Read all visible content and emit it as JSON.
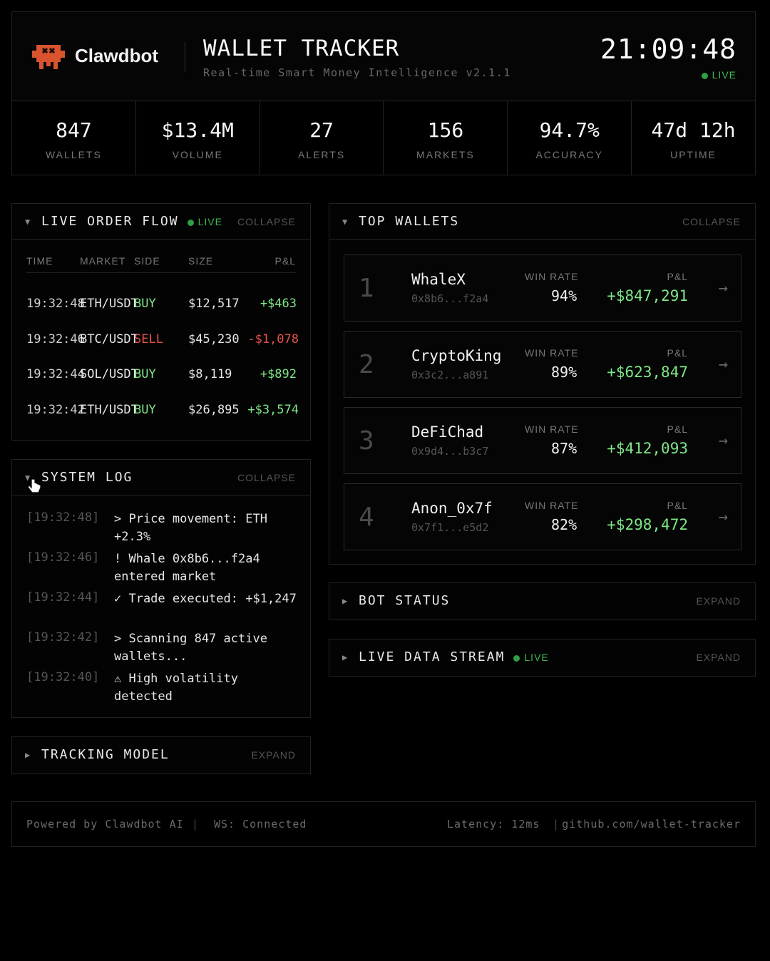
{
  "header": {
    "brand": "Clawdbot",
    "title": "WALLET TRACKER",
    "subtitle": "Real-time Smart Money Intelligence v2.1.1",
    "clock": "21:09:48",
    "live": "LIVE",
    "logo_icon": "clawdbot-logo-icon",
    "accent_color": "#d9532e"
  },
  "stats": [
    {
      "value": "847",
      "label": "WALLETS"
    },
    {
      "value": "$13.4M",
      "label": "VOLUME"
    },
    {
      "value": "27",
      "label": "ALERTS"
    },
    {
      "value": "156",
      "label": "MARKETS"
    },
    {
      "value": "94.7%",
      "label": "ACCURACY"
    },
    {
      "value": "47d 12h",
      "label": "UPTIME"
    }
  ],
  "order_flow": {
    "title": "LIVE ORDER FLOW",
    "live": "LIVE",
    "action": "COLLAPSE",
    "columns": [
      "TIME",
      "MARKET",
      "SIDE",
      "SIZE",
      "P&L"
    ],
    "rows": [
      {
        "time": "19:32:48",
        "market": "ETH/USDT",
        "side": "BUY",
        "size": "$12,517",
        "pnl": "+$463"
      },
      {
        "time": "19:32:46",
        "market": "BTC/USDT",
        "side": "SELL",
        "size": "$45,230",
        "pnl": "-$1,078"
      },
      {
        "time": "19:32:44",
        "market": "SOL/USDT",
        "side": "BUY",
        "size": "$8,119",
        "pnl": "+$892"
      },
      {
        "time": "19:32:42",
        "market": "ETH/USDT",
        "side": "BUY",
        "size": "$26,895",
        "pnl": "+$3,574"
      }
    ]
  },
  "system_log": {
    "title": "SYSTEM LOG",
    "action": "COLLAPSE",
    "entries": [
      {
        "time": "[19:32:48]",
        "msg": "> Price movement: ETH +2.3%"
      },
      {
        "time": "[19:32:46]",
        "msg": "! Whale 0x8b6...f2a4 entered market"
      },
      {
        "time": "[19:32:44]",
        "msg": "✓ Trade executed: +$1,247"
      },
      {
        "time": "[19:32:42]",
        "msg": "> Scanning 847 active wallets..."
      },
      {
        "time": "[19:32:40]",
        "msg": "⚠ High volatility detected"
      }
    ]
  },
  "tracking_model": {
    "title": "TRACKING MODEL",
    "action": "EXPAND"
  },
  "top_wallets": {
    "title": "TOP WALLETS",
    "action": "COLLAPSE",
    "win_rate_label": "WIN RATE",
    "pnl_label": "P&L",
    "wallets": [
      {
        "rank": "1",
        "name": "WhaleX",
        "address": "0x8b6...f2a4",
        "win_rate": "94%",
        "pnl": "+$847,291"
      },
      {
        "rank": "2",
        "name": "CryptoKing",
        "address": "0x3c2...a891",
        "win_rate": "89%",
        "pnl": "+$623,847"
      },
      {
        "rank": "3",
        "name": "DeFiChad",
        "address": "0x9d4...b3c7",
        "win_rate": "87%",
        "pnl": "+$412,093"
      },
      {
        "rank": "4",
        "name": "Anon_0x7f",
        "address": "0x7f1...e5d2",
        "win_rate": "82%",
        "pnl": "+$298,472"
      }
    ]
  },
  "bot_status": {
    "title": "BOT STATUS",
    "action": "EXPAND"
  },
  "live_stream": {
    "title": "LIVE DATA STREAM",
    "live": "LIVE",
    "action": "EXPAND"
  },
  "footer": {
    "powered": "Powered by Clawdbot AI",
    "sep": "|",
    "ws": "WS: Connected",
    "latency": "Latency: 12ms",
    "github": "github.com/wallet-tracker"
  }
}
